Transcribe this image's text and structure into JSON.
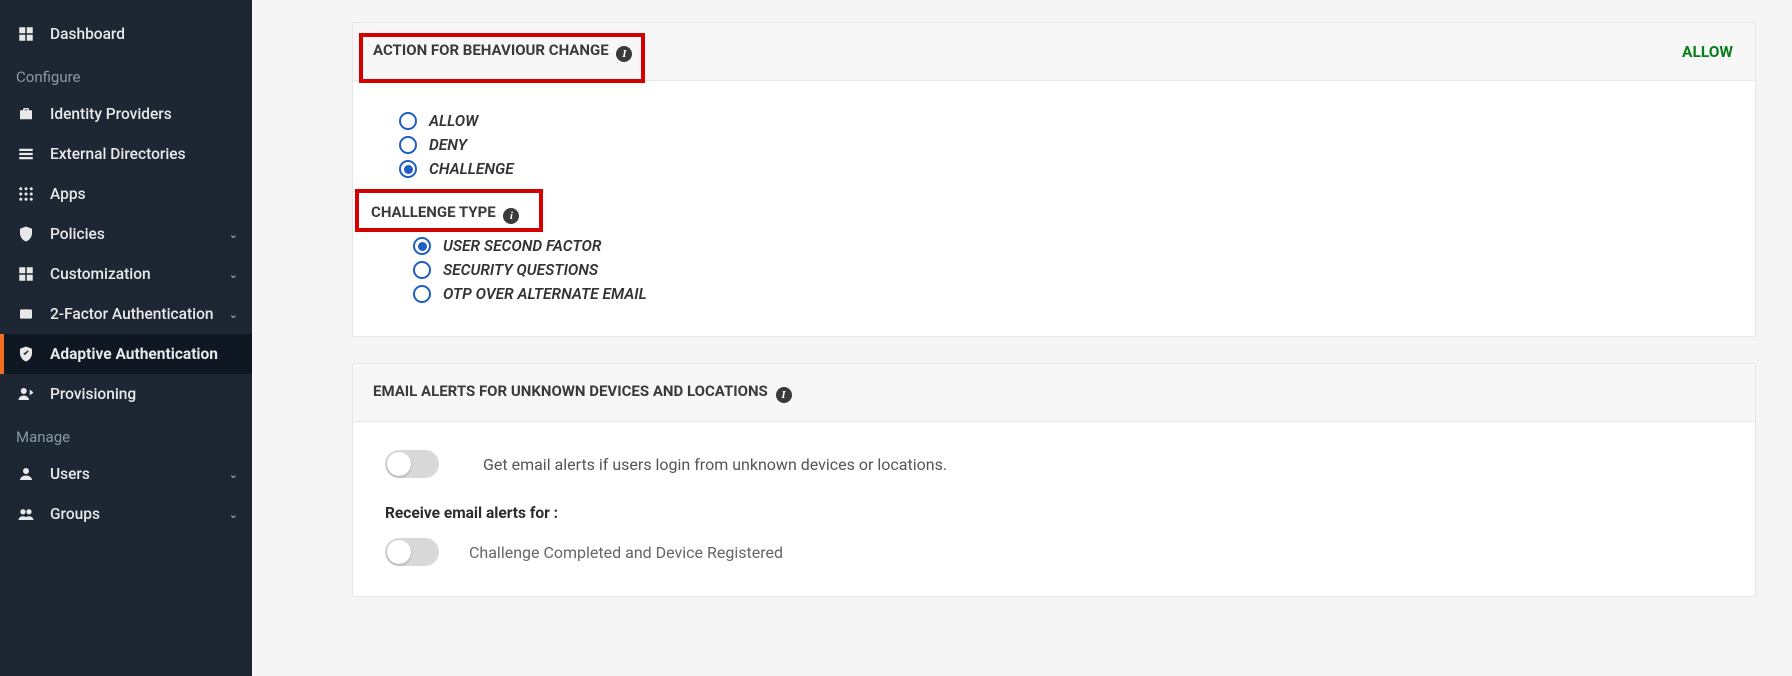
{
  "sidebar": {
    "configureLabel": "Configure",
    "manageLabel": "Manage",
    "items": {
      "dashboard": "Dashboard",
      "identityProviders": "Identity Providers",
      "externalDirectories": "External Directories",
      "apps": "Apps",
      "policies": "Policies",
      "customization": "Customization",
      "twoFactor": "2-Factor Authentication",
      "adaptive": "Adaptive Authentication",
      "provisioning": "Provisioning",
      "users": "Users",
      "groups": "Groups"
    }
  },
  "actionCard": {
    "title": "ACTION FOR BEHAVIOUR CHANGE",
    "status": "ALLOW",
    "options": {
      "allow": "ALLOW",
      "deny": "DENY",
      "challenge": "CHALLENGE"
    },
    "selectedAction": "challenge",
    "challengeHeading": "CHALLENGE TYPE",
    "challengeOptions": {
      "secondFactor": "USER SECOND FACTOR",
      "securityQuestions": "SECURITY QUESTIONS",
      "otpEmail": "OTP OVER ALTERNATE EMAIL"
    },
    "selectedChallenge": "secondFactor"
  },
  "alertsCard": {
    "title": "EMAIL ALERTS FOR UNKNOWN DEVICES AND LOCATIONS",
    "desc": "Get email alerts if users login from unknown devices or locations.",
    "receiveHeading": "Receive email alerts for :",
    "option1": "Challenge Completed and Device Registered"
  }
}
